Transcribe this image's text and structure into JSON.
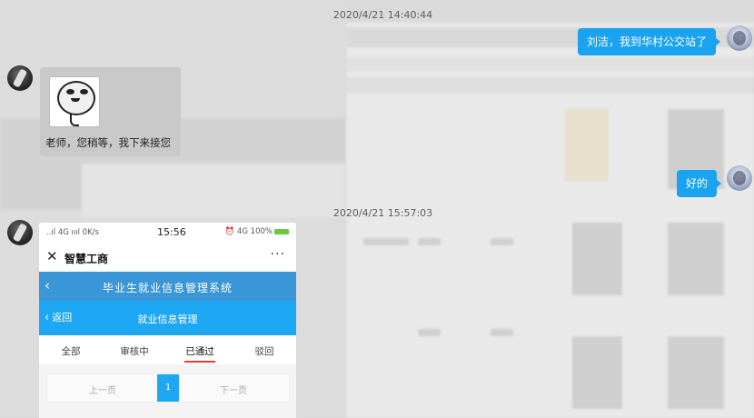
{
  "messages": {
    "timestamp_1": "2020/4/21 14:40:44",
    "me_1": "刘洁，我到华村公交站了",
    "them_1_caption": "老师，您稍等，我下来接您",
    "me_2": "好的",
    "timestamp_2": "2020/4/21 15:57:03"
  },
  "phone": {
    "status_left": "..ıl 4G ıııl 0K/s",
    "time": "15:56",
    "status_right": "⏰ 4G 100%",
    "app_name": "智慧工商",
    "more": "···",
    "system_title": "毕业生就业信息管理系统",
    "back_label": "返回",
    "page_title": "就业信息管理",
    "tabs": [
      "全部",
      "审核中",
      "已通过",
      "驳回"
    ],
    "pager": {
      "prev": "上一页",
      "page": "1",
      "next": "下一页"
    }
  },
  "colors": {
    "bubble": "#1aa3f0",
    "nav": "#1ea7f2",
    "system_bar": "#3a96d6"
  }
}
